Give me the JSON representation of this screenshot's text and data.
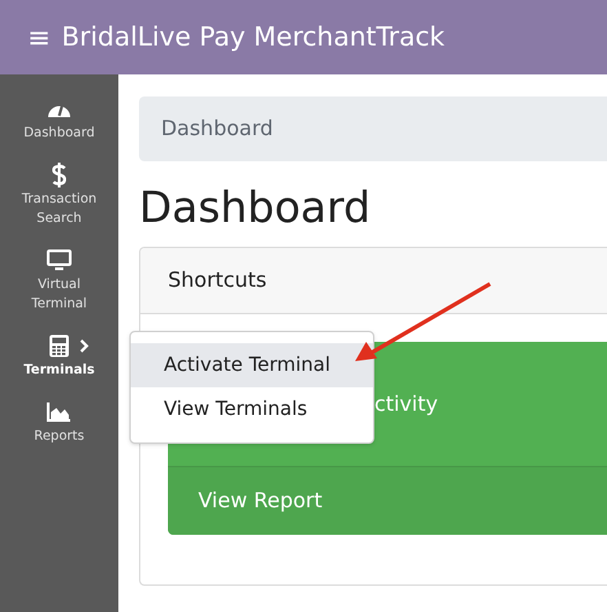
{
  "header": {
    "menu_glyph": "≡",
    "title": "BridalLive Pay MerchantTrack"
  },
  "sidebar": {
    "items": [
      {
        "label": "Dashboard",
        "kind": "gauge",
        "selected": false,
        "has_submenu": false
      },
      {
        "label": "Transaction Search",
        "kind": "dollar",
        "selected": false,
        "has_submenu": false
      },
      {
        "label": "Virtual Terminal",
        "kind": "monitor",
        "selected": false,
        "has_submenu": false
      },
      {
        "label": "Terminals",
        "kind": "calculator",
        "selected": true,
        "has_submenu": true
      },
      {
        "label": "Reports",
        "kind": "chart",
        "selected": false,
        "has_submenu": false
      }
    ]
  },
  "breadcrumb": "Dashboard",
  "page_title": "Dashboard",
  "card": {
    "header": "Shortcuts",
    "tile": {
      "title": "ctivity",
      "action": "View Report"
    }
  },
  "submenu": {
    "items": [
      {
        "label": "Activate Terminal",
        "selected": true
      },
      {
        "label": "View Terminals",
        "selected": false
      }
    ]
  }
}
